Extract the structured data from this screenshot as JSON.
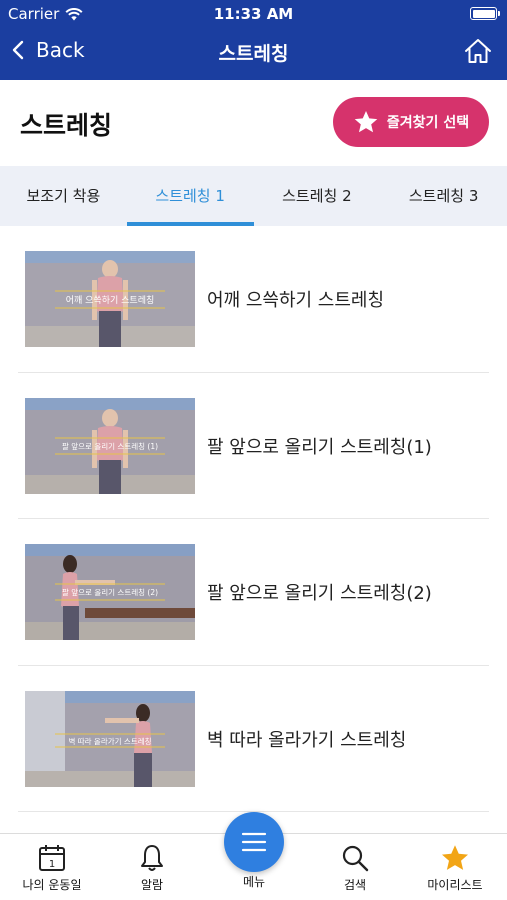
{
  "status": {
    "carrier": "Carrier",
    "time": "11:33 AM"
  },
  "nav": {
    "back_label": "Back",
    "title": "스트레칭"
  },
  "page": {
    "heading": "스트레칭",
    "favorite_button": "즐겨찾기 선택"
  },
  "tabs": [
    {
      "label": "보조기 착용",
      "active": false
    },
    {
      "label": "스트레칭 1",
      "active": true
    },
    {
      "label": "스트레칭 2",
      "active": false
    },
    {
      "label": "스트레칭 3",
      "active": false
    }
  ],
  "videos": [
    {
      "title": "어깨 으쓱하기 스트레칭",
      "thumb_caption": "어깨 으쓱하기 스트레칭"
    },
    {
      "title": "팔 앞으로 올리기 스트레칭(1)",
      "thumb_caption": "팔 앞으로 올리기 스트레칭 (1)"
    },
    {
      "title": "팔 앞으로 올리기 스트레칭(2)",
      "thumb_caption": "팔 앞으로 올리기 스트레칭 (2)"
    },
    {
      "title": "벽 따라 올라가기 스트레칭",
      "thumb_caption": "벽 따라 올라가기 스트레칭"
    }
  ],
  "bottom_nav": {
    "my_day": "나의 운동일",
    "calendar_day": "1",
    "alarm": "알람",
    "menu": "메뉴",
    "search": "검색",
    "my_list": "마이리스트"
  },
  "colors": {
    "header": "#1b3ea0",
    "accent": "#2f8fd8",
    "favorite": "#d6336c",
    "star": "#f2a516",
    "fab": "#2f7fe0"
  }
}
